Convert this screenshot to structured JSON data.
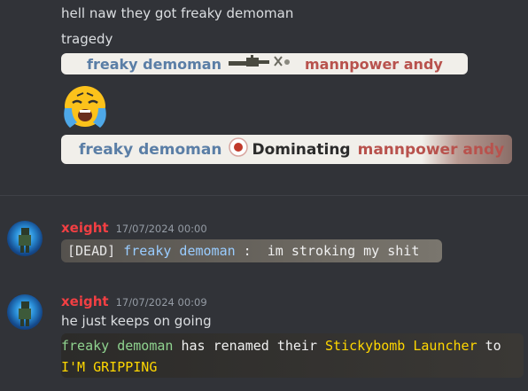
{
  "messages_top": {
    "line1": "hell naw they got freaky demoman",
    "line2": "tragedy"
  },
  "killfeed1": {
    "killer": "freaky demoman",
    "weapon_icon": "sticky-launcher-icon",
    "victim": "mannpower andy"
  },
  "emoji": "crying-face-emoji",
  "killfeed2": {
    "killer": "freaky demoman",
    "status_icon": "domination-icon",
    "status": "Dominating",
    "victim": "mannpower andy"
  },
  "message1": {
    "username": "xeight",
    "timestamp": "17/07/2024 00:00",
    "chat_dead": "[DEAD]",
    "chat_name": "freaky demoman",
    "chat_sep": " :  ",
    "chat_text": "im stroking my shit"
  },
  "message2": {
    "username": "xeight",
    "timestamp": "17/07/2024 00:09",
    "text": "he just keeps on going",
    "rename_name": "freaky demoman",
    "rename_mid": " has renamed their ",
    "rename_item": "Stickybomb Launcher",
    "rename_to": " to",
    "rename_newname": "I'M GRIPPING"
  },
  "colors": {
    "background": "#313338",
    "username": "#f23f43",
    "killfeed_blue": "#5a7ea6",
    "killfeed_red": "#b8524d",
    "chat_name_blue": "#99ccff",
    "unique_yellow": "#ffd700",
    "rename_green": "#8fd38f"
  }
}
